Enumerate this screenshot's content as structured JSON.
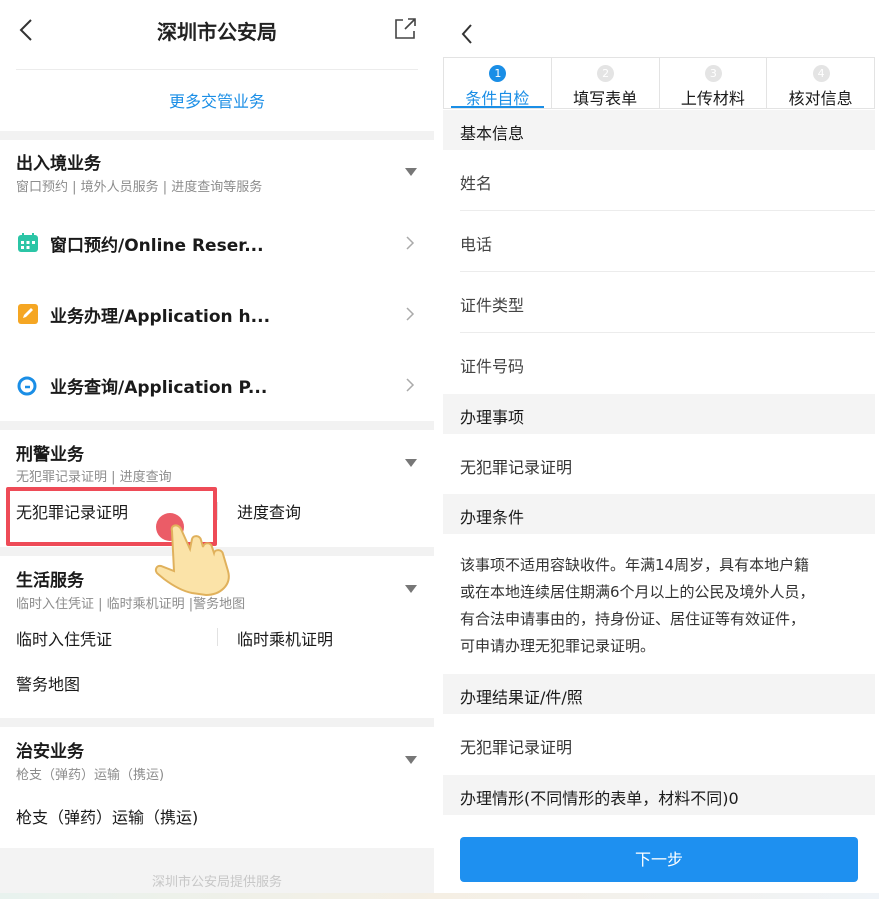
{
  "left": {
    "header": {
      "title": "深圳市公安局"
    },
    "more_link": "更多交管业务",
    "sections": {
      "immigration": {
        "title": "出入境业务",
        "subtitle": "窗口预约 | 境外人员服务 | 进度查询等服务",
        "items": [
          {
            "label": "窗口预约/Online Reser...",
            "icon": "calendar-icon"
          },
          {
            "label": "业务办理/Application h...",
            "icon": "edit-icon"
          },
          {
            "label": "业务查询/Application P...",
            "icon": "search-icon"
          }
        ]
      },
      "criminal": {
        "title": "刑警业务",
        "subtitle": "无犯罪记录证明 | 进度查询",
        "items": [
          "无犯罪记录证明",
          "进度查询"
        ]
      },
      "life": {
        "title": "生活服务",
        "subtitle": "临时入住凭证 | 临时乘机证明 |警务地图",
        "items": [
          "临时入住凭证",
          "临时乘机证明",
          "警务地图"
        ]
      },
      "security": {
        "title": "治安业务",
        "subtitle": "枪支（弹药）运输（携运)",
        "items": [
          "枪支（弹药）运输（携运)"
        ]
      }
    },
    "footer": "深圳市公安局提供服务"
  },
  "right": {
    "steps": [
      {
        "num": "1",
        "label": "条件自检"
      },
      {
        "num": "2",
        "label": "填写表单"
      },
      {
        "num": "3",
        "label": "上传材料"
      },
      {
        "num": "4",
        "label": "核对信息"
      }
    ],
    "basic_info": {
      "title": "基本信息",
      "fields": [
        "姓名",
        "电话",
        "证件类型",
        "证件号码"
      ]
    },
    "matter": {
      "title": "办理事项",
      "value": "无犯罪记录证明"
    },
    "conditions": {
      "title": "办理条件",
      "lines": [
        "该事项不适用容缺收件。年满14周岁，具有本地户籍",
        "或在本地连续居住期满6个月以上的公民及境外人员，",
        "有合法申请事由的，持身份证、居住证等有效证件，",
        "可申请办理无犯罪记录证明。"
      ]
    },
    "result": {
      "title": "办理结果证/件/照",
      "value": "无犯罪记录证明"
    },
    "situation": {
      "title": "办理情形(不同情形的表单，材料不同)0"
    },
    "next_button": "下一步"
  },
  "colors": {
    "accent": "#1a8ee6",
    "highlight": "#ee4b57",
    "section_bg": "#f4f4f4"
  }
}
